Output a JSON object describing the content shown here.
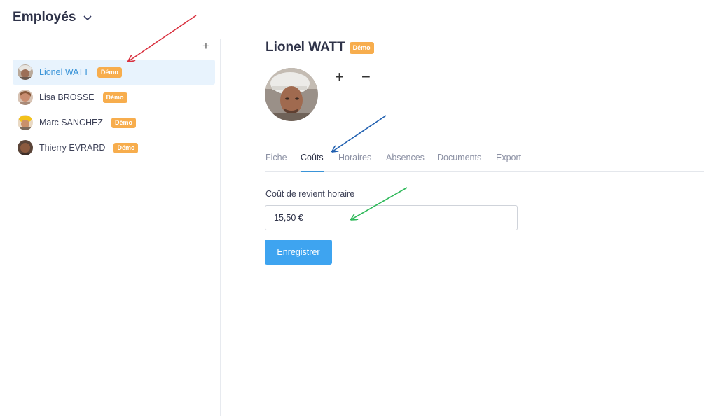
{
  "header": {
    "title": "Employés"
  },
  "sidebar": {
    "add_label": "+",
    "employees": [
      {
        "name": "Lionel WATT",
        "badge": "Démo",
        "active": true
      },
      {
        "name": "Lisa BROSSE",
        "badge": "Démo",
        "active": false
      },
      {
        "name": "Marc SANCHEZ",
        "badge": "Démo",
        "active": false
      },
      {
        "name": "Thierry EVRARD",
        "badge": "Démo",
        "active": false
      }
    ]
  },
  "detail": {
    "name": "Lionel WATT",
    "badge": "Démo",
    "photo_add": "+",
    "photo_remove": "−",
    "tabs": [
      {
        "label": "Fiche"
      },
      {
        "label": "Coûts"
      },
      {
        "label": "Horaires"
      },
      {
        "label": "Absences"
      },
      {
        "label": "Documents"
      },
      {
        "label": "Export"
      }
    ],
    "active_tab": "Coûts",
    "cost_form": {
      "label": "Coût de revient horaire",
      "value": "15,50 €",
      "save_label": "Enregistrer"
    }
  },
  "colors": {
    "accent": "#3a94d8",
    "button": "#3ea4f0",
    "badge": "#f7ad4d",
    "arrow_red": "#d9303e",
    "arrow_blue": "#1f5fb0",
    "arrow_green": "#2fb95a"
  },
  "icons": [
    "chevron-down-icon",
    "plus-icon",
    "minus-icon"
  ]
}
